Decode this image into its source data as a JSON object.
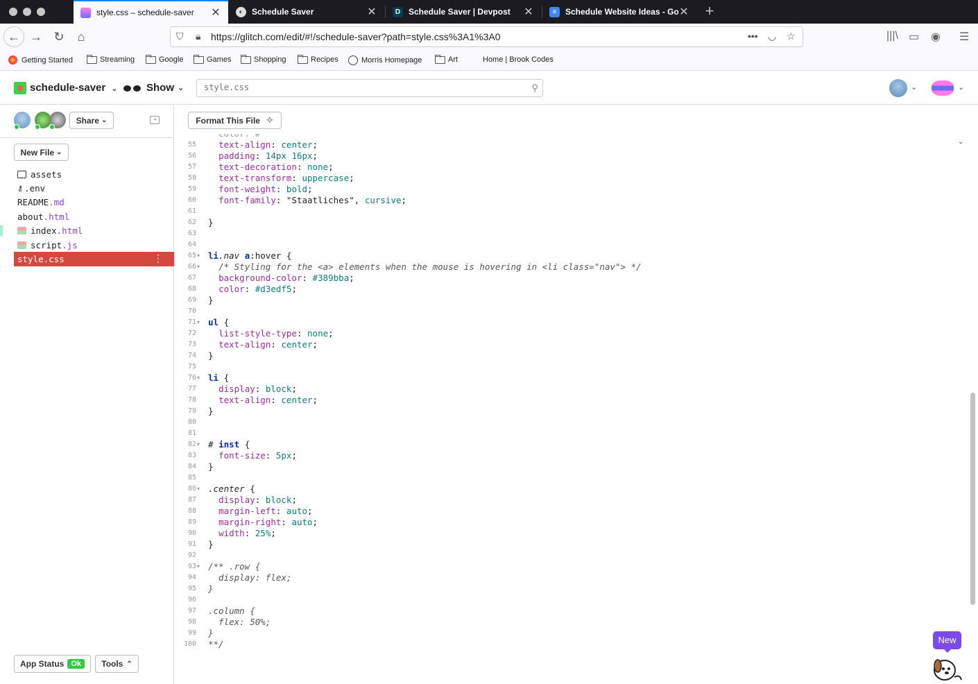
{
  "browser": {
    "tabs": [
      {
        "title": "style.css – schedule-saver",
        "active": true
      },
      {
        "title": "Schedule Saver",
        "active": false
      },
      {
        "title": "Schedule Saver | Devpost",
        "active": false
      },
      {
        "title": "Schedule Website Ideas - Goog",
        "active": false
      }
    ],
    "url": "https://glitch.com/edit/#!/schedule-saver?path=style.css%3A1%3A0",
    "bookmarks": [
      "Getting Started",
      "Streaming",
      "Google",
      "Games",
      "Shopping",
      "Recipes",
      "Morris Homepage",
      "Art",
      "Home | Brook Codes"
    ]
  },
  "header": {
    "project_name": "schedule-saver",
    "show_label": "Show",
    "search_placeholder": "style.css"
  },
  "sidebar": {
    "share_label": "Share",
    "new_file_label": "New File",
    "files": [
      {
        "name": "assets",
        "ext": "",
        "icon": "archive-icon"
      },
      {
        "name": ".env",
        "ext": "",
        "icon": "key-icon"
      },
      {
        "name": "README",
        "ext": ".md",
        "icon": ""
      },
      {
        "name": "about",
        "ext": ".html",
        "icon": ""
      },
      {
        "name": "index",
        "ext": ".html",
        "icon": "file-icon"
      },
      {
        "name": "script",
        "ext": ".js",
        "icon": "file-icon"
      },
      {
        "name": "style.css",
        "ext": "",
        "icon": "",
        "selected": true
      }
    ],
    "app_status_label": "App Status",
    "app_status_badge": "Ok",
    "tools_label": "Tools"
  },
  "editor": {
    "format_label": "Format This File",
    "new_badge": "New",
    "line_numbers": [
      "55",
      "56",
      "57",
      "58",
      "59",
      "60",
      "61",
      "62",
      "63",
      "64",
      "65",
      "66",
      "67",
      "68",
      "69",
      "70",
      "71",
      "72",
      "73",
      "74",
      "75",
      "76",
      "77",
      "78",
      "79",
      "80",
      "81",
      "82",
      "83",
      "84",
      "85",
      "86",
      "87",
      "88",
      "89",
      "90",
      "91",
      "92",
      "93",
      "94",
      "95",
      "96",
      "97",
      "98",
      "99",
      "100"
    ],
    "fold_lines": [
      "65",
      "66",
      "71",
      "76",
      "82",
      "86",
      "93"
    ],
    "lines": [
      [
        {
          "t": "  "
        },
        {
          "c": "p",
          "t": "text-align"
        },
        {
          "t": ": "
        },
        {
          "c": "v",
          "t": "center"
        },
        {
          "t": ";"
        }
      ],
      [
        {
          "t": "  "
        },
        {
          "c": "p",
          "t": "padding"
        },
        {
          "t": ": "
        },
        {
          "c": "n",
          "t": "14px 16px"
        },
        {
          "t": ";"
        }
      ],
      [
        {
          "t": "  "
        },
        {
          "c": "p",
          "t": "text-decoration"
        },
        {
          "t": ": "
        },
        {
          "c": "v",
          "t": "none"
        },
        {
          "t": ";"
        }
      ],
      [
        {
          "t": "  "
        },
        {
          "c": "p",
          "t": "text-transform"
        },
        {
          "t": ": "
        },
        {
          "c": "v",
          "t": "uppercase"
        },
        {
          "t": ";"
        }
      ],
      [
        {
          "t": "  "
        },
        {
          "c": "p",
          "t": "font-weight"
        },
        {
          "t": ": "
        },
        {
          "c": "v",
          "t": "bold"
        },
        {
          "t": ";"
        }
      ],
      [
        {
          "t": "  "
        },
        {
          "c": "p",
          "t": "font-family"
        },
        {
          "t": ": "
        },
        {
          "c": "s",
          "t": "\"Staatliches\""
        },
        {
          "t": ", "
        },
        {
          "c": "v",
          "t": "cursive"
        },
        {
          "t": ";"
        }
      ],
      [],
      [
        {
          "t": "}"
        }
      ],
      [],
      [],
      [
        {
          "c": "k",
          "t": "li"
        },
        {
          "c": "sel-i",
          "t": ".nav"
        },
        {
          "t": " "
        },
        {
          "c": "k",
          "t": "a"
        },
        {
          "t": ":hover {"
        }
      ],
      [
        {
          "t": "  "
        },
        {
          "c": "c",
          "t": "/* Styling for the <a> elements when the mouse is hovering in <li class=\"nav\"> */"
        }
      ],
      [
        {
          "t": "  "
        },
        {
          "c": "p",
          "t": "background-color"
        },
        {
          "t": ": "
        },
        {
          "c": "n",
          "t": "#389bba"
        },
        {
          "t": ";"
        }
      ],
      [
        {
          "t": "  "
        },
        {
          "c": "p",
          "t": "color"
        },
        {
          "t": ": "
        },
        {
          "c": "n",
          "t": "#d3edf5"
        },
        {
          "t": ";"
        }
      ],
      [
        {
          "t": "}"
        }
      ],
      [],
      [
        {
          "c": "k",
          "t": "ul"
        },
        {
          "t": " {"
        }
      ],
      [
        {
          "t": "  "
        },
        {
          "c": "p",
          "t": "list-style-type"
        },
        {
          "t": ": "
        },
        {
          "c": "v",
          "t": "none"
        },
        {
          "t": ";"
        }
      ],
      [
        {
          "t": "  "
        },
        {
          "c": "p",
          "t": "text-align"
        },
        {
          "t": ": "
        },
        {
          "c": "v",
          "t": "center"
        },
        {
          "t": ";"
        }
      ],
      [
        {
          "t": "}"
        }
      ],
      [],
      [
        {
          "c": "k",
          "t": "li"
        },
        {
          "t": " {"
        }
      ],
      [
        {
          "t": "  "
        },
        {
          "c": "p",
          "t": "display"
        },
        {
          "t": ": "
        },
        {
          "c": "v",
          "t": "block"
        },
        {
          "t": ";"
        }
      ],
      [
        {
          "t": "  "
        },
        {
          "c": "p",
          "t": "text-align"
        },
        {
          "t": ": "
        },
        {
          "c": "v",
          "t": "center"
        },
        {
          "t": ";"
        }
      ],
      [
        {
          "t": "}"
        }
      ],
      [],
      [],
      [
        {
          "t": "# "
        },
        {
          "c": "k",
          "t": "inst"
        },
        {
          "t": " {"
        }
      ],
      [
        {
          "t": "  "
        },
        {
          "c": "p",
          "t": "font-size"
        },
        {
          "t": ": "
        },
        {
          "c": "n",
          "t": "5px"
        },
        {
          "t": ";"
        }
      ],
      [
        {
          "t": "}"
        }
      ],
      [],
      [
        {
          "c": "sel-i",
          "t": ".center"
        },
        {
          "t": " {"
        }
      ],
      [
        {
          "t": "  "
        },
        {
          "c": "p",
          "t": "display"
        },
        {
          "t": ": "
        },
        {
          "c": "v",
          "t": "block"
        },
        {
          "t": ";"
        }
      ],
      [
        {
          "t": "  "
        },
        {
          "c": "p",
          "t": "margin-left"
        },
        {
          "t": ": "
        },
        {
          "c": "v",
          "t": "auto"
        },
        {
          "t": ";"
        }
      ],
      [
        {
          "t": "  "
        },
        {
          "c": "p",
          "t": "margin-right"
        },
        {
          "t": ": "
        },
        {
          "c": "v",
          "t": "auto"
        },
        {
          "t": ";"
        }
      ],
      [
        {
          "t": "  "
        },
        {
          "c": "p",
          "t": "width"
        },
        {
          "t": ": "
        },
        {
          "c": "n",
          "t": "25%"
        },
        {
          "t": ";"
        }
      ],
      [
        {
          "t": "}"
        }
      ],
      [],
      [
        {
          "c": "c",
          "t": "/** .row {"
        }
      ],
      [
        {
          "c": "c",
          "t": "  display: flex;"
        }
      ],
      [
        {
          "c": "c",
          "t": "}"
        }
      ],
      [],
      [
        {
          "c": "c",
          "t": ".column {"
        }
      ],
      [
        {
          "c": "c",
          "t": "  flex: 50%;"
        }
      ],
      [
        {
          "c": "c",
          "t": "}"
        }
      ],
      [
        {
          "c": "c",
          "t": "**/"
        }
      ]
    ]
  },
  "colors": {
    "selected_file_bg": "#d5483e",
    "status_ok": "#2ecc40",
    "new_badge": "#7b4ae8",
    "tab_accent": "#0a84ff"
  }
}
